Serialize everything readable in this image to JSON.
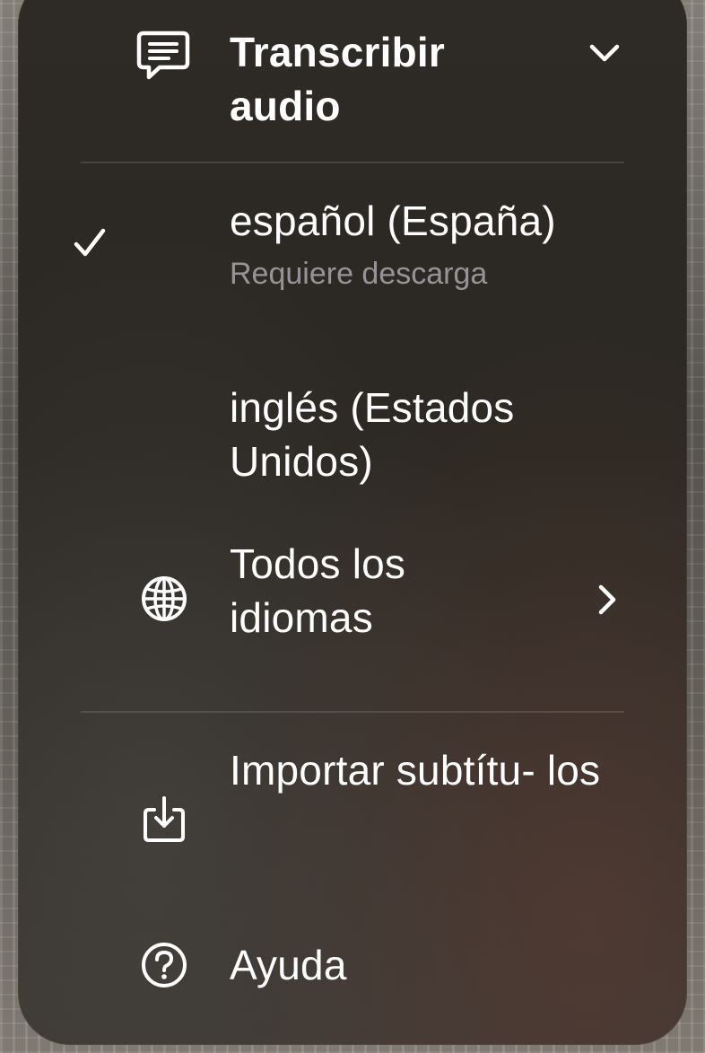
{
  "menu": {
    "header": {
      "icon": "speech-bubble-icon",
      "title": "Transcribir audio",
      "chevron_icon": "chevron-down-icon"
    },
    "languages": [
      {
        "label": "español (España)",
        "sublabel": "Requiere descarga",
        "selected": true,
        "check_icon": "checkmark-icon"
      },
      {
        "label": "inglés (Estados Unidos)",
        "selected": false
      }
    ],
    "all_languages": {
      "icon": "globe-icon",
      "label": "Todos los idiomas",
      "chevron_icon": "chevron-right-icon"
    },
    "import_subtitles": {
      "icon": "import-tray-icon",
      "label": "Importar subtítu- los"
    },
    "help": {
      "icon": "question-circle-icon",
      "label": "Ayuda"
    }
  }
}
